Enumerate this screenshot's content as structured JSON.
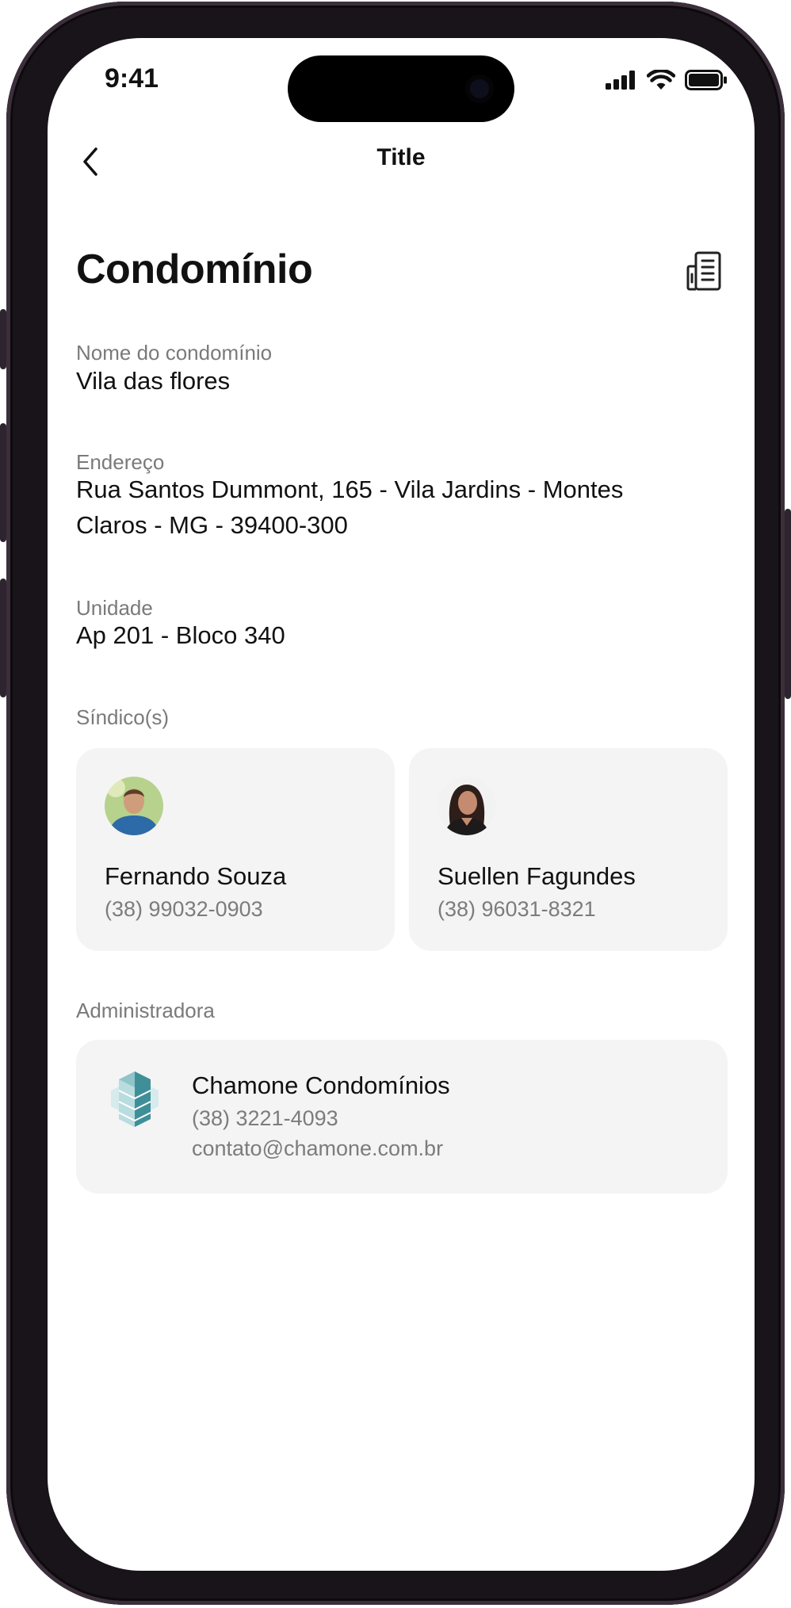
{
  "status_bar": {
    "time": "9:41"
  },
  "nav": {
    "title": "Title"
  },
  "page": {
    "heading": "Condomínio"
  },
  "fields": {
    "name_label": "Nome do condomínio",
    "name_value": "Vila das flores",
    "address_label": "Endereço",
    "address_line1": "Rua Santos Dummont, 165 - Vila Jardins - Montes",
    "address_line2": "Claros - MG - 39400-300",
    "unit_label": "Unidade",
    "unit_value": "Ap 201 - Bloco 340"
  },
  "sindicos": {
    "label": "Síndico(s)",
    "items": [
      {
        "name": "Fernando Souza",
        "phone": "(38) 99032-0903"
      },
      {
        "name": "Suellen Fagundes",
        "phone": "(38) 96031-8321"
      }
    ]
  },
  "administradora": {
    "label": "Administradora",
    "name": "Chamone Condomínios",
    "phone": "(38) 3221-4093",
    "email": "contato@chamone.com.br"
  },
  "icons": {
    "back": "chevron-left-icon",
    "building": "building-icon",
    "signal": "cellular-signal-icon",
    "wifi": "wifi-icon",
    "battery": "battery-icon"
  },
  "colors": {
    "card_background": "#f4f4f4",
    "secondary_text": "#7a7a7a",
    "primary_text": "#111111"
  }
}
